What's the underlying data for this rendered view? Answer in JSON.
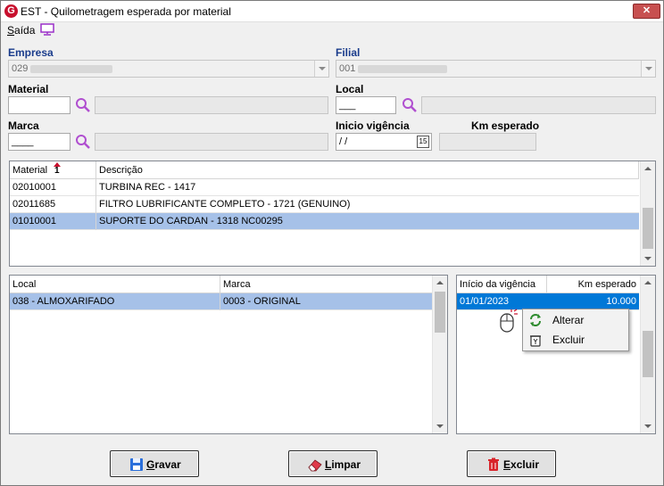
{
  "window": {
    "title": "EST - Quilometragem esperada por material",
    "close_glyph": "✕"
  },
  "app_logo": "G",
  "menu": {
    "saida": "Saída",
    "saida_mnemonic": "S",
    "saida_rest": "aída"
  },
  "form": {
    "empresa": {
      "label": "Empresa",
      "value": "029"
    },
    "filial": {
      "label": "Filial",
      "value": "001"
    },
    "material": {
      "label": "Material",
      "value": ""
    },
    "local": {
      "label": "Local",
      "value": "___"
    },
    "marca": {
      "label": "Marca",
      "value": "____"
    },
    "inicio_vigencia": {
      "label": "Inicio vigência",
      "value": "/ /"
    },
    "km_esperado": {
      "label": "Km esperado",
      "value": ""
    },
    "calendar_day": "15"
  },
  "materials_grid": {
    "columns": [
      "Material",
      "Descrição"
    ],
    "sort_indicator": "1",
    "rows": [
      {
        "material": "02010001",
        "descricao": "TURBINA REC - 1417"
      },
      {
        "material": "02011685",
        "descricao": "FILTRO LUBRIFICANTE COMPLETO - 1721 (GENUINO)"
      },
      {
        "material": "01010001",
        "descricao": "SUPORTE DO CARDAN - 1318 NC00295"
      }
    ],
    "selected_index": 2
  },
  "local_grid": {
    "columns": [
      "Local",
      "Marca"
    ],
    "rows": [
      {
        "local": "038 - ALMOXARIFADO",
        "marca": "0003 - ORIGINAL"
      }
    ]
  },
  "vigencia_grid": {
    "columns": [
      "Início da vigência",
      "Km esperado"
    ],
    "rows": [
      {
        "inicio": "01/01/2023",
        "km": "10.000"
      }
    ]
  },
  "context_menu": {
    "items": [
      {
        "label": "Alterar",
        "icon": "refresh-icon"
      },
      {
        "label": "Excluir",
        "icon": "recycle-bin-icon"
      }
    ]
  },
  "buttons": {
    "gravar": {
      "label": "Gravar",
      "mnemonic": "G",
      "rest": "ravar",
      "icon": "floppy-disk-icon"
    },
    "limpar": {
      "label": "Limpar",
      "mnemonic": "L",
      "rest": "impar",
      "icon": "eraser-icon"
    },
    "excluir": {
      "label": "Excluir",
      "mnemonic": "E",
      "rest": "xcluir",
      "icon": "trash-icon"
    }
  },
  "colors": {
    "label_blue": "#1a3c8c",
    "selection_blue": "#0078d7",
    "row_highlight": "#a6c1e8",
    "search_purple": "#b04fd0"
  }
}
